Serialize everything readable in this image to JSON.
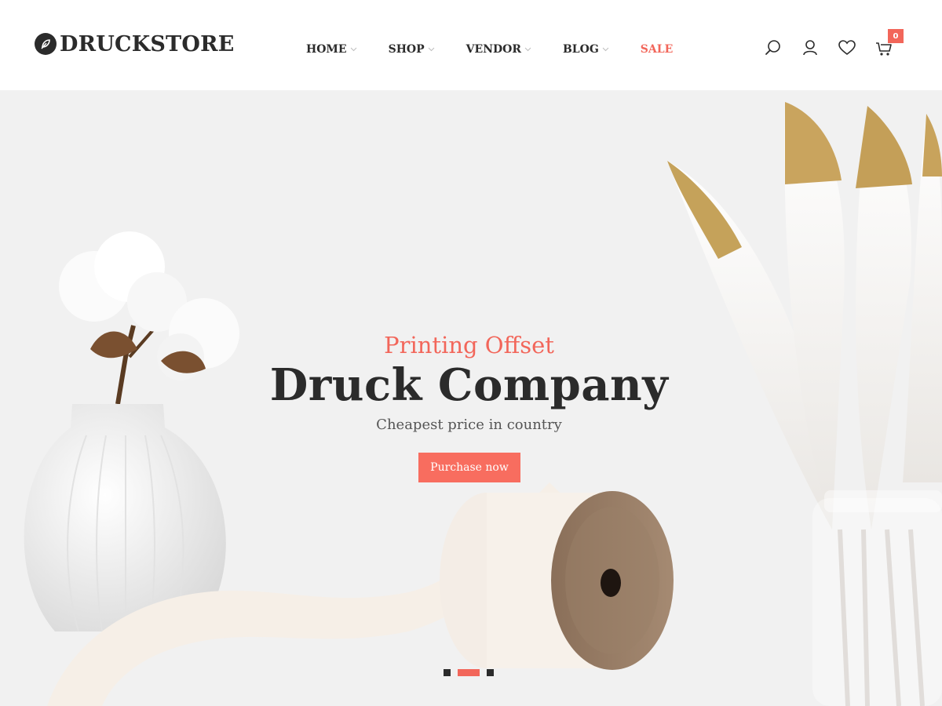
{
  "brand": {
    "name": "DRUCKSTORE",
    "logo_icon": "leaf-icon"
  },
  "nav": {
    "items": [
      {
        "label": "HOME",
        "has_dropdown": true
      },
      {
        "label": "SHOP",
        "has_dropdown": true
      },
      {
        "label": "VENDOR",
        "has_dropdown": true
      },
      {
        "label": "BLOG",
        "has_dropdown": true
      },
      {
        "label": "SALE",
        "has_dropdown": false
      }
    ]
  },
  "header_icons": {
    "search": "search-icon",
    "account": "user-icon",
    "wishlist": "heart-icon",
    "cart": "cart-icon",
    "cart_count": "0"
  },
  "hero": {
    "subtitle": "Printing Offset",
    "title": "Druck Company",
    "tagline": "Cheapest price in country",
    "cta_label": "Purchase now",
    "slides_total": 3,
    "active_slide": 2
  },
  "colors": {
    "accent": "#f2665a",
    "text_dark": "#2b2b2b",
    "hero_bg": "#f1f1f1"
  }
}
